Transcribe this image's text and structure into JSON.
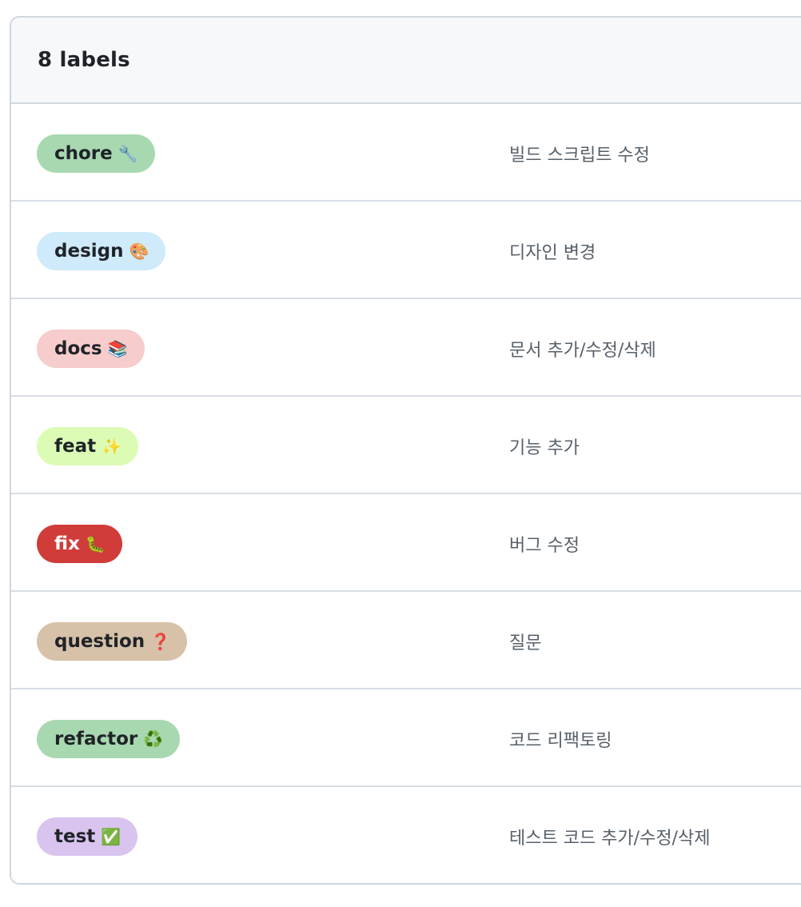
{
  "header": {
    "title": "8 labels"
  },
  "labels": [
    {
      "name": "chore",
      "emoji": "🔧",
      "description": "빌드 스크립트 수정",
      "bg": "#a8d8b0",
      "fg": "#1f2328"
    },
    {
      "name": "design",
      "emoji": "🎨",
      "description": "디자인 변경",
      "bg": "#cfeafb",
      "fg": "#1f2328"
    },
    {
      "name": "docs",
      "emoji": "📚",
      "description": "문서 추가/수정/삭제",
      "bg": "#f6cccc",
      "fg": "#1f2328"
    },
    {
      "name": "feat",
      "emoji": "✨",
      "description": "기능 추가",
      "bg": "#dcfcb6",
      "fg": "#1f2328"
    },
    {
      "name": "fix",
      "emoji": "🐛",
      "description": "버그 수정",
      "bg": "#d03c3a",
      "fg": "#ffffff"
    },
    {
      "name": "question",
      "emoji": "❓",
      "description": "질문",
      "bg": "#d7c1a9",
      "fg": "#1f2328"
    },
    {
      "name": "refactor",
      "emoji": "♻️",
      "description": "코드 리팩토링",
      "bg": "#a8d8b0",
      "fg": "#1f2328"
    },
    {
      "name": "test",
      "emoji": "✅",
      "description": "테스트 코드 추가/수정/삭제",
      "bg": "#d8c4ee",
      "fg": "#1f2328"
    }
  ]
}
